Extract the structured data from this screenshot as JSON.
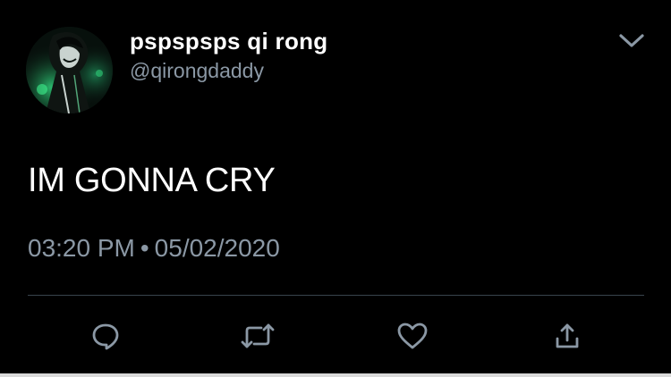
{
  "user": {
    "display_name": "pspspsps qi rong",
    "handle": "@qirongdaddy"
  },
  "tweet": {
    "text": "IM GONNA CRY",
    "time": "03:20 PM",
    "separator": "•",
    "date": "05/02/2020"
  },
  "icons": {
    "menu": "chevron-down-icon",
    "reply": "reply-bubble-icon",
    "retweet": "retweet-arrows-icon",
    "like": "heart-icon",
    "share": "share-upload-icon"
  },
  "colors": {
    "background": "#000000",
    "text_primary": "#ffffff",
    "text_secondary": "#8b98a5",
    "icon": "#8b98a5",
    "divider": "#38444d"
  }
}
